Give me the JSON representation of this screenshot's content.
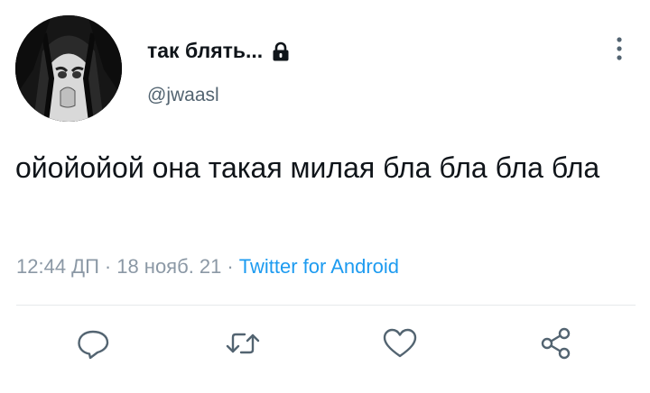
{
  "tweet": {
    "display_name": "так блять...",
    "handle": "@jwaasl",
    "text": "ойойойой она такая милая бла бла бла бла",
    "time": "12:44 ДП",
    "separator": "·",
    "date": "18 нояб. 21",
    "source": "Twitter for Android"
  },
  "icons": {
    "lock": "lock-icon",
    "more": "more-vertical-icon",
    "reply": "reply-icon",
    "retweet": "retweet-icon",
    "like": "heart-icon",
    "share": "share-icon"
  },
  "colors": {
    "text": "#0f1419",
    "secondary": "#536471",
    "meta": "#8b98a5",
    "link": "#1d9bf0",
    "icon": "#536471"
  }
}
